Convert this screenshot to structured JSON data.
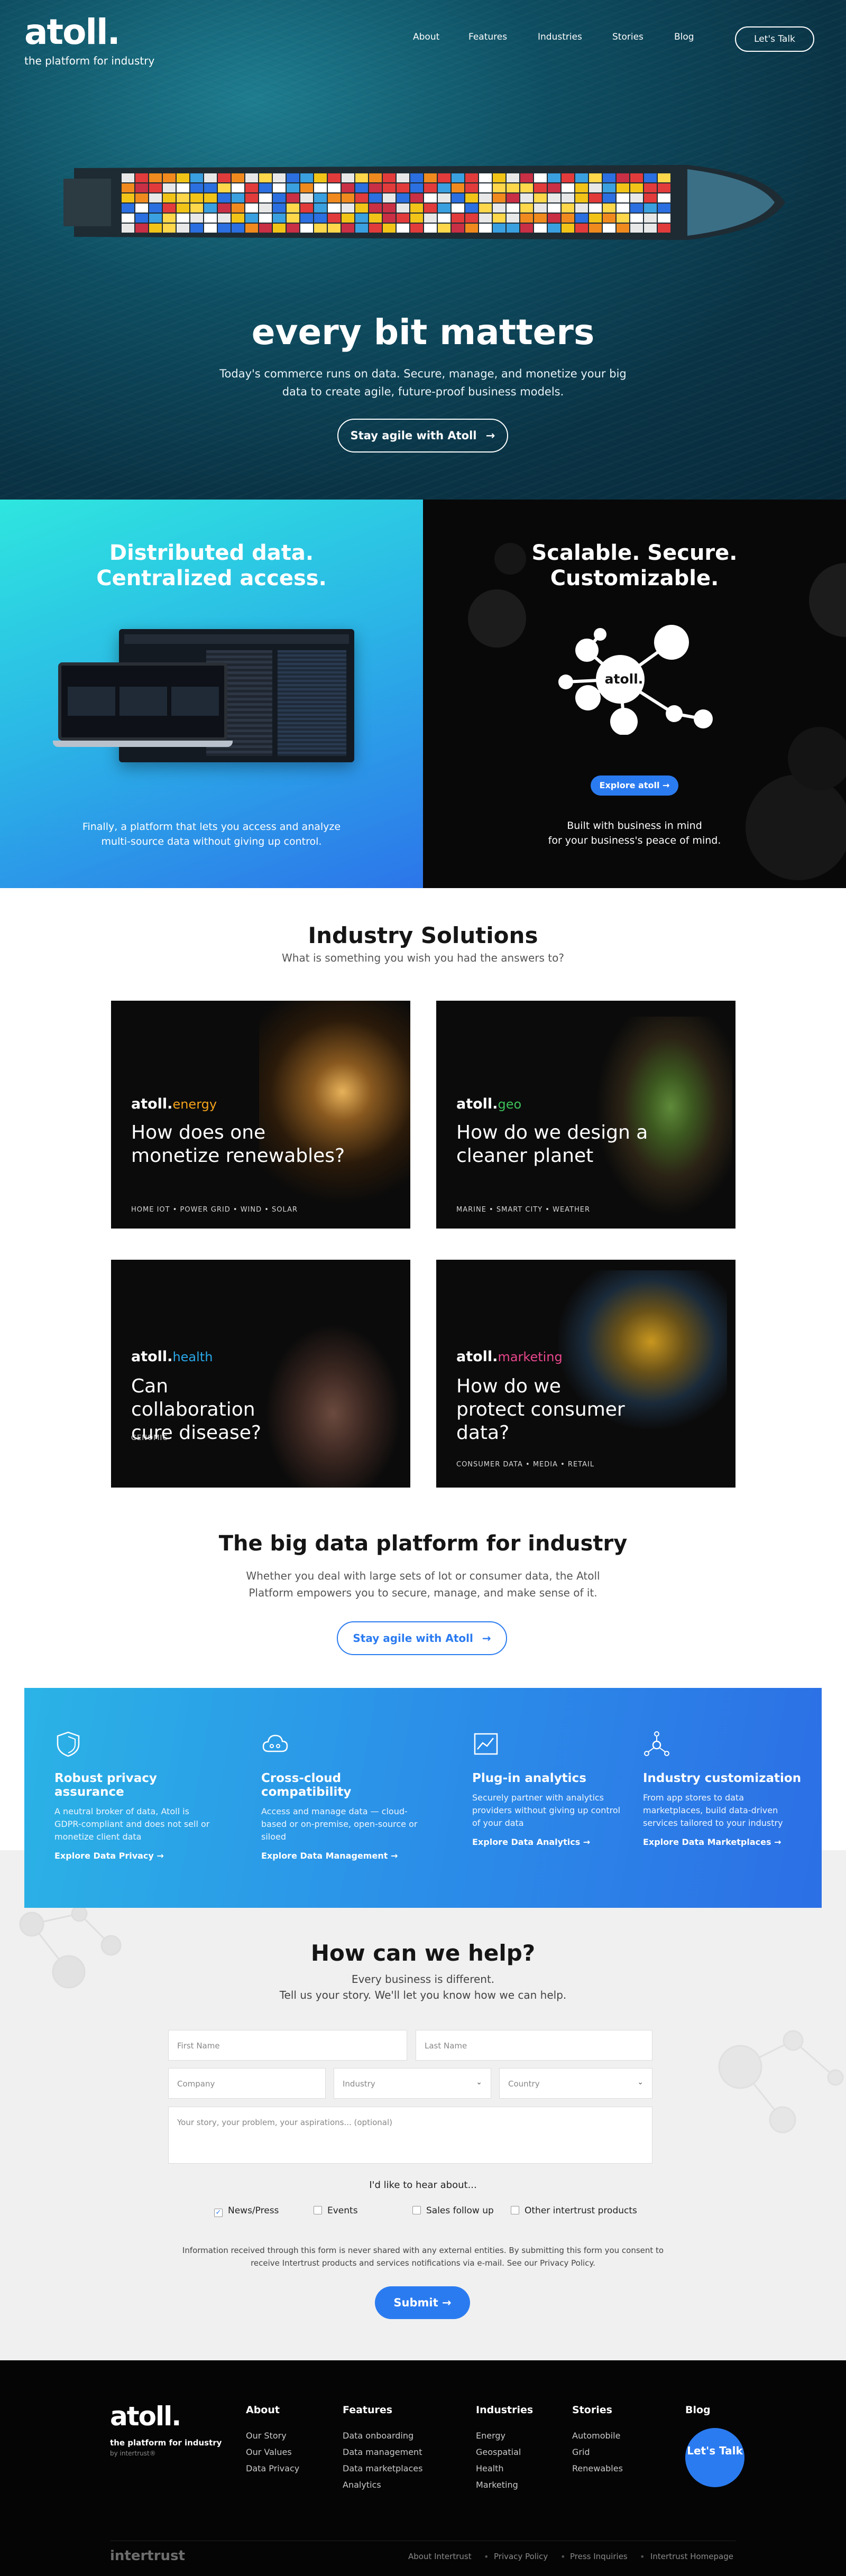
{
  "header": {
    "logo": "atoll.",
    "tagline": "the platform for industry",
    "nav": [
      "About",
      "Features",
      "Industries",
      "Stories",
      "Blog"
    ],
    "cta": "Let's Talk"
  },
  "hero": {
    "title": "every bit matters",
    "subtitle": "Today's commerce runs on data. Secure, manage, and monetize your big data to create agile, future-proof business models.",
    "button": "Stay agile with Atoll"
  },
  "panels": {
    "left": {
      "title_line1": "Distributed data.",
      "title_line2": "Centralized access.",
      "text": "Finally, a platform that lets you access and analyze multi-source data without giving up control."
    },
    "right": {
      "title_line1": "Scalable. Secure.",
      "title_line2": "Customizable.",
      "hub_label": "atoll.",
      "button": "Explore atoll",
      "text_line1": "Built with business in mind",
      "text_line2": "for your business's peace of mind."
    }
  },
  "industry": {
    "title": "Industry Solutions",
    "subtitle": "What is something you wish you had the answers to?",
    "cards": [
      {
        "brand": "atoll.",
        "vertical": "energy",
        "color": "#f2a21b",
        "question": "How does one monetize renewables?",
        "tags": "HOME IOT  •  POWER GRID  •  WIND  •  SOLAR"
      },
      {
        "brand": "atoll.",
        "vertical": "geo",
        "color": "#3cc05a",
        "question": "How do we design a cleaner planet",
        "tags": "MARINE  •  SMART CITY  •  WEATHER"
      },
      {
        "brand": "atoll.",
        "vertical": "health",
        "color": "#29a7e8",
        "question": "Can collaboration cure disease?",
        "tags": "GENOMIC"
      },
      {
        "brand": "atoll.",
        "vertical": "marketing",
        "color": "#e8478c",
        "question": "How do we protect consumer data?",
        "tags": "CONSUMER DATA  •  MEDIA  •  RETAIL"
      }
    ]
  },
  "platform": {
    "title": "The big data platform for industry",
    "text": "Whether you deal with large sets of Iot or consumer data, the Atoll Platform empowers you to secure, manage, and make sense of it.",
    "button": "Stay agile with Atoll"
  },
  "features": [
    {
      "icon": "shield-icon",
      "title": "Robust privacy assurance",
      "text": "A neutral broker of data, Atoll is GDPR-compliant and does not sell or monetize client data",
      "link": "Explore Data Privacy"
    },
    {
      "icon": "cloud-icon",
      "title": "Cross-cloud compatibility",
      "text": "Access and manage data — cloud-based or on-premise, open-source or siloed",
      "link": "Explore Data Management"
    },
    {
      "icon": "analytics-icon",
      "title": "Plug-in analytics",
      "text": "Securely partner with analytics providers without giving up control of your data",
      "link": "Explore Data Analytics"
    },
    {
      "icon": "network-icon",
      "title": "Industry customization",
      "text": "From app stores to data marketplaces, build data-driven services tailored to your industry",
      "link": "Explore Data Marketplaces"
    }
  ],
  "help": {
    "title": "How can we help?",
    "sub1": "Every business is different.",
    "sub2": "Tell us your story. We'll let you know how we can help.",
    "first_name": "First Name",
    "last_name": "Last Name",
    "company": "Company",
    "industry": "Industry",
    "country": "Country",
    "story": "Your story, your problem, your aspirations... (optional)",
    "hear_label": "I'd like to hear about...",
    "options": [
      {
        "label": "News/Press",
        "checked": true
      },
      {
        "label": "Events",
        "checked": false
      },
      {
        "label": "Sales follow up",
        "checked": false
      },
      {
        "label": "Other intertrust products",
        "checked": false
      }
    ],
    "disclaimer": "Information received through this form is never shared with any external entities. By submitting this form you consent to receive Intertrust products and services notifications via e-mail. See our Privacy Policy.",
    "submit": "Submit"
  },
  "footer": {
    "logo": "atoll.",
    "tagline": "the platform for industry",
    "by": "by intertrust®",
    "columns": [
      {
        "title": "About",
        "links": [
          "Our Story",
          "Our Values",
          "Data Privacy"
        ]
      },
      {
        "title": "Features",
        "links": [
          "Data onboarding",
          "Data management",
          "Data marketplaces",
          "Analytics"
        ]
      },
      {
        "title": "Industries",
        "links": [
          "Energy",
          "Geospatial",
          "Health",
          "Marketing"
        ]
      },
      {
        "title": "Stories",
        "links": [
          "Automobile",
          "Grid",
          "Renewables"
        ]
      },
      {
        "title": "Blog",
        "links": []
      }
    ],
    "talk": "Let's Talk",
    "brand": "intertrust",
    "bottom_links": [
      "About Intertrust",
      "Privacy Policy",
      "Press Inquiries",
      "Intertrust Homepage"
    ]
  }
}
